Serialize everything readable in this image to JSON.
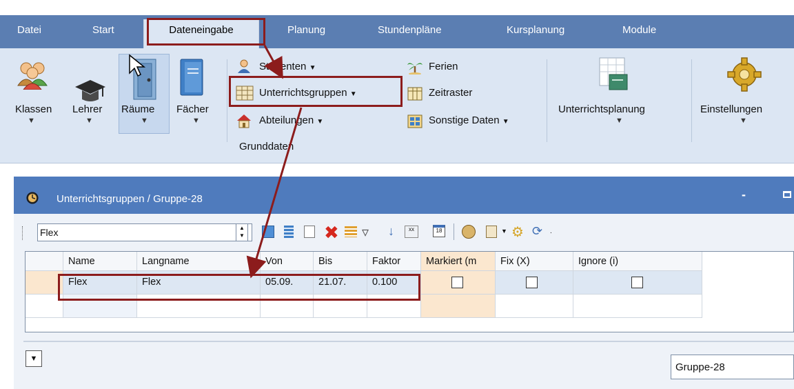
{
  "menu": {
    "tabs": [
      {
        "label": "Datei"
      },
      {
        "label": "Start"
      },
      {
        "label": "Dateneingabe"
      },
      {
        "label": "Planung"
      },
      {
        "label": "Stundenpläne"
      },
      {
        "label": "Kursplanung"
      },
      {
        "label": "Module"
      }
    ],
    "active": "Dateneingabe"
  },
  "ribbon": {
    "large_buttons": [
      {
        "label": "Klassen"
      },
      {
        "label": "Lehrer"
      },
      {
        "label": "Räume"
      },
      {
        "label": "Fächer"
      }
    ],
    "small_buttons": {
      "studenten": "Studenten",
      "unterrichtsgruppen": "Unterrichtsgruppen",
      "abteilungen": "Abteilungen",
      "ferien": "Ferien",
      "zeitraster": "Zeitraster",
      "sonstige": "Sonstige Daten"
    },
    "group_label": "Grunddaten",
    "unterrichtsplanung": "Unterrichtsplanung",
    "einstellungen": "Einstellungen"
  },
  "window": {
    "title": "Unterrichtsgruppen / Gruppe-28",
    "minimize": "-"
  },
  "toolbar": {
    "filter_value": "Flex"
  },
  "grid": {
    "columns": [
      "Name",
      "Langname",
      "Von",
      "Bis",
      "Faktor",
      "Markiert (m",
      "Fix (X)",
      "Ignore (i)"
    ],
    "rows": [
      {
        "name": "Flex",
        "langname": "Flex",
        "von": "05.09.",
        "bis": "21.07.",
        "faktor": "0.100",
        "markiert": false,
        "fix": false,
        "ignore": false
      }
    ]
  },
  "footer": {
    "selector_value": "Gruppe-28"
  },
  "colors": {
    "menu_bar": "#5b7eb2",
    "ribbon": "#dce6f3",
    "window_title": "#4f7bbd",
    "highlight": "#8c1c1c",
    "markiert_column": "#fbe7cf"
  }
}
